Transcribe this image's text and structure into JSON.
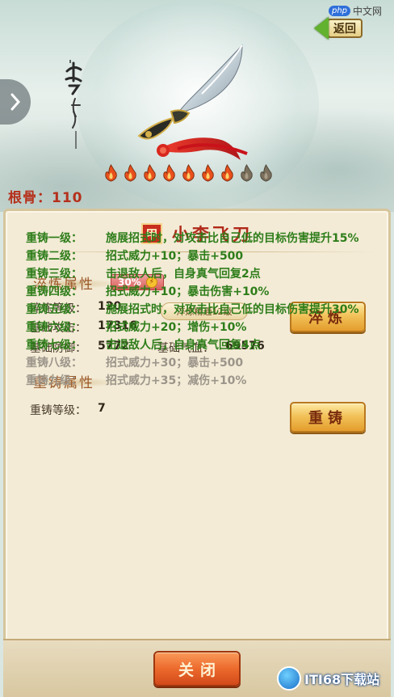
{
  "header": {
    "back_label": "返回",
    "root_label": "根骨：110",
    "calligraphy_text": "李寻欢"
  },
  "watermarks": {
    "top_logo": "php",
    "top_text": "中文网",
    "bottom_text": "ITI68下载站"
  },
  "weapon": {
    "grade": "甲",
    "name": "小李飞刀",
    "flames": [
      {
        "state": "lit"
      },
      {
        "state": "lit"
      },
      {
        "state": "lit"
      },
      {
        "state": "lit"
      },
      {
        "state": "lit"
      },
      {
        "state": "lit"
      },
      {
        "state": "lit"
      },
      {
        "state": "unlit"
      },
      {
        "state": "unlit"
      }
    ]
  },
  "temper": {
    "title": "淬炼属性",
    "percent_badge": "30%",
    "level_label": "淬炼等级：",
    "level_value": "120",
    "mastery_badge": "淬炼精通12级",
    "attack_label": "基础攻击：",
    "attack_value": "17316",
    "defense_label": "基础防御：",
    "defense_value": "5772",
    "hp_label": "基础气血：",
    "hp_value": "69576",
    "button_label": "淬炼"
  },
  "reforge": {
    "title": "重铸属性",
    "level_label": "重铸等级：",
    "level_value": "7",
    "button_label": "重铸",
    "items": [
      {
        "level": "重铸一级：",
        "desc": "施展招式时，对攻击比自己低的目标伤害提升15%",
        "unlocked": true
      },
      {
        "level": "重铸二级：",
        "desc": "招式威力+10；暴击+500",
        "unlocked": true
      },
      {
        "level": "重铸三级：",
        "desc": "击退敌人后，自身真气回复2点",
        "unlocked": true
      },
      {
        "level": "重铸四级：",
        "desc": "招式威力+10；暴击伤害+10%",
        "unlocked": true
      },
      {
        "level": "重铸五级：",
        "desc": "施展招式时，对攻击比自己低的目标伤害提升30%",
        "unlocked": true
      },
      {
        "level": "重铸六级：",
        "desc": "招式威力+20；增伤+10%",
        "unlocked": true
      },
      {
        "level": "重铸七级：",
        "desc": "击退敌人后，自身真气回复4点",
        "unlocked": true
      },
      {
        "level": "重铸八级：",
        "desc": "招式威力+30；暴击+500",
        "unlocked": false
      },
      {
        "level": "重铸九级：",
        "desc": "招式威力+35；减伤+10%",
        "unlocked": false
      }
    ]
  },
  "footer": {
    "close_label": "关闭"
  },
  "colors": {
    "unlocked_text": "#2e7d1a",
    "locked_text": "#9c958a",
    "title_red": "#b12a1a",
    "flame_lit": "#e8501c",
    "flame_unlit": "#7a6f5c"
  }
}
